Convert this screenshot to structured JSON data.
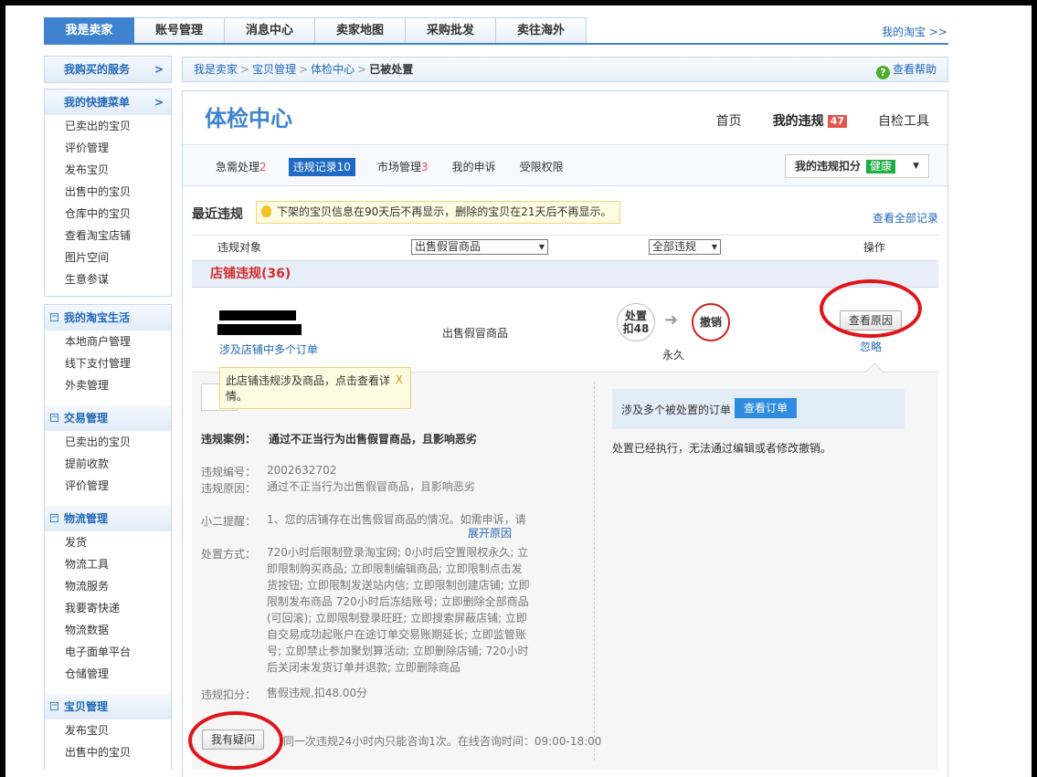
{
  "top_nav": {
    "tabs": [
      "我是卖家",
      "账号管理",
      "消息中心",
      "卖家地图",
      "采购批发",
      "卖往海外"
    ],
    "my_taobao": "我的淘宝 >>"
  },
  "sidebar": {
    "my_services": "我购买的服务",
    "my_services_arrow": ">",
    "quick_menu": {
      "title": "我的快捷菜单",
      "arrow": ">",
      "items": [
        "已卖出的宝贝",
        "评价管理",
        "发布宝贝",
        "出售中的宝贝",
        "仓库中的宝贝",
        "查看淘宝店铺",
        "图片空间",
        "生意参谋"
      ]
    },
    "groups": [
      {
        "title": "我的淘宝生活",
        "items": [
          "本地商户管理",
          "线下支付管理",
          "外卖管理"
        ]
      },
      {
        "title": "交易管理",
        "items": [
          "已卖出的宝贝",
          "提前收款",
          "评价管理"
        ]
      },
      {
        "title": "物流管理",
        "items": [
          "发货",
          "物流工具",
          "物流服务",
          "我要寄快递",
          "物流数据",
          "电子面单平台",
          "仓储管理"
        ]
      },
      {
        "title": "宝贝管理",
        "items": [
          "发布宝贝",
          "出售中的宝贝"
        ]
      }
    ]
  },
  "breadcrumb": {
    "items": [
      "我是卖家",
      "宝贝管理",
      "体检中心"
    ],
    "current": "已被处置",
    "separator": ">",
    "help": "查看帮助"
  },
  "main": {
    "title": "体检中心",
    "nav": {
      "home": "首页",
      "my_violations": "我的违规",
      "violation_count": "47",
      "self_check": "自检工具"
    },
    "subtabs": [
      {
        "label": "急需处理",
        "count": "2"
      },
      {
        "label": "违规记录",
        "count": "10"
      },
      {
        "label": "市场管理",
        "count": "3"
      },
      {
        "label": "我的申诉",
        "count": ""
      },
      {
        "label": "受限权限",
        "count": ""
      }
    ],
    "deduct": {
      "label": "我的违规扣分",
      "status": "健康"
    },
    "recent": {
      "title": "最近违规",
      "tip": "下架的宝贝信息在90天后不再显示，删除的宝贝在21天后不再显示。",
      "view_all": "查看全部记录"
    },
    "columns": {
      "object": "违规对象",
      "type_select": "出售假冒商品",
      "scope_select": "全部违规",
      "action": "操作"
    },
    "shop_violation": "店铺违规(36)",
    "record": {
      "involved_link": "涉及店铺中多个订单",
      "violation_type": "出售假冒商品",
      "punish_line1": "处置",
      "punish_line2": "扣48",
      "revoked": "撤销",
      "duration": "永久",
      "view_reason": "查看原因",
      "ignore": "忽略"
    },
    "tooltip": "此店铺违规涉及商品，点击查看详情。",
    "tooltip_close": "X",
    "detail": {
      "case_label": "违规案例：",
      "case_text": "通过不正当行为出售假冒商品，且影响恶劣",
      "number_label": "违规编号：",
      "number": "2002632702",
      "reason_label": "违规原因：",
      "reason": "通过不正当行为出售假冒商品，且影响恶劣",
      "reminder_label": "小二提醒：",
      "reminder": "1、您的店铺存在出售假冒商品的情况。如需申诉，请",
      "expand": "展开原因",
      "method_label": "处置方式：",
      "method": "720小时后限制登录淘宝网; 0小时后空置限权永久; 立即限制购买商品; 立即限制编辑商品; 立即限制点击发货按钮; 立即限制发送站内信; 立即限制创建店铺; 立即限制发布商品 720小时后冻结账号; 立即删除全部商品(可回滚); 立即限制登录旺旺; 立即搜索屏蔽店铺; 立即自交易成功起账户在途订单交易账期延长; 立即监管账号; 立即禁止参加聚划算活动; 立即删除店铺; 720小时后关闭未发货订单并退款; 立即删除商品",
      "points_label": "违规扣分：",
      "points": "售假违规,扣48.00分",
      "doubt_button": "我有疑问",
      "doubt_note": "同一次违规24小时内只能咨询1次。在线咨询时间：09:00-18:00",
      "order_text": "涉及多个被处置的订单",
      "order_button": "查看订单",
      "executed": "处置已经执行，无法通过编辑或者修改撤销。"
    }
  },
  "colors": {
    "accent": "#3f83d0",
    "link": "#2168b8",
    "alert": "#d12d2d",
    "annotation_ring": "#e2141a"
  }
}
